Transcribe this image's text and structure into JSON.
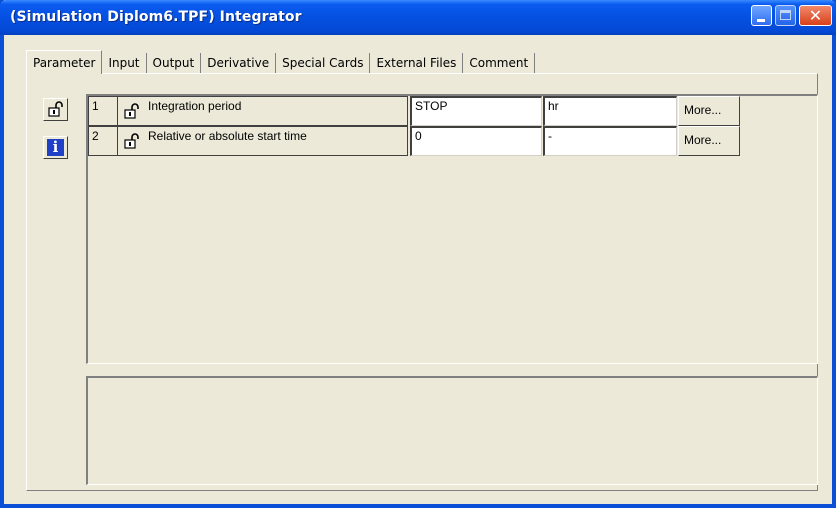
{
  "window": {
    "title": "(Simulation Diplom6.TPF) Integrator",
    "accent_color": "#0a4fd6",
    "controls": {
      "minimize_icon": "minimize-icon",
      "maximize_icon": "maximize-icon",
      "close_icon": "close-icon"
    }
  },
  "tabs": [
    {
      "label": "Parameter",
      "active": true
    },
    {
      "label": "Input"
    },
    {
      "label": "Output"
    },
    {
      "label": "Derivative"
    },
    {
      "label": "Special Cards"
    },
    {
      "label": "External Files"
    },
    {
      "label": "Comment"
    }
  ],
  "sidebar": {
    "lock_icon": "padlock-icon",
    "info_icon": "info-icon",
    "info_glyph": "i"
  },
  "parameters": [
    {
      "index": "1",
      "name": "Integration period",
      "value": "STOP",
      "unit": "hr",
      "more_label": "More..."
    },
    {
      "index": "2",
      "name": "Relative or absolute start time",
      "value": "0",
      "unit": "-",
      "more_label": "More..."
    }
  ],
  "description": ""
}
